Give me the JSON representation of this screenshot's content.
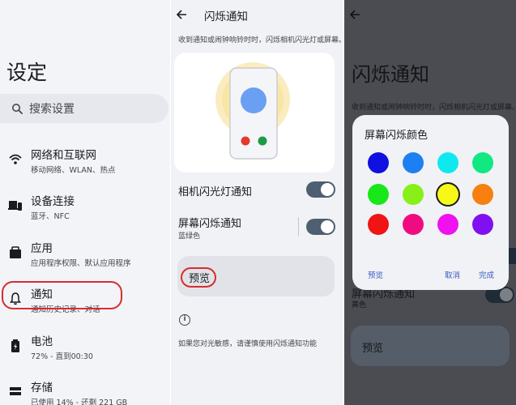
{
  "settings": {
    "title": "设定",
    "search_placeholder": "搜索设置",
    "items": [
      {
        "icon": "wifi-icon",
        "label": "网络和互联网",
        "sub": "移动网络、WLAN、热点"
      },
      {
        "icon": "devices-icon",
        "label": "设备连接",
        "sub": "蓝牙、NFC"
      },
      {
        "icon": "apps-icon",
        "label": "应用",
        "sub": "应用程序权限、默认应用程序"
      },
      {
        "icon": "bell-icon",
        "label": "通知",
        "sub": "通知历史记录、对话"
      },
      {
        "icon": "battery-icon",
        "label": "电池",
        "sub": "72% - 直到00:30"
      },
      {
        "icon": "storage-icon",
        "label": "存储",
        "sub": "已使用 14% - 还剩 221 GB"
      }
    ]
  },
  "flash": {
    "title": "闪烁通知",
    "description": "收到通知或闹钟响铃时时，闪烁相机闪光灯或屏幕。",
    "camera_flash_label": "相机闪光灯通知",
    "camera_flash_on": true,
    "screen_flash_label": "屏幕闪烁通知",
    "screen_flash_sub": "蓝绿色",
    "screen_flash_on": true,
    "preview_label": "预览",
    "note": "如果您对光敏感，请谨慎使用闪烁通知功能"
  },
  "dialog_screen": {
    "title": "闪烁通知",
    "description": "收到通知或闹钟响铃时时，闪烁相机闪光灯或屏幕。",
    "screen_flash_label": "屏幕闪烁通知",
    "screen_flash_sub": "黄色",
    "preview_label": "预览",
    "dialog": {
      "title": "屏幕闪烁颜色",
      "colors": [
        "#1010e0",
        "#1e80f0",
        "#10e8f0",
        "#10e882",
        "#18e818",
        "#88f018",
        "#f8f818",
        "#f88010",
        "#f01414",
        "#f00c80",
        "#f010f0",
        "#8010f0"
      ],
      "selected_index": 6,
      "preview_button": "预览",
      "cancel_button": "取消",
      "done_button": "完成"
    }
  },
  "colors": {
    "annotation_red": "#d72d2d",
    "toggle_on": "#4e5f72",
    "dim_background": "#4a4c52"
  }
}
